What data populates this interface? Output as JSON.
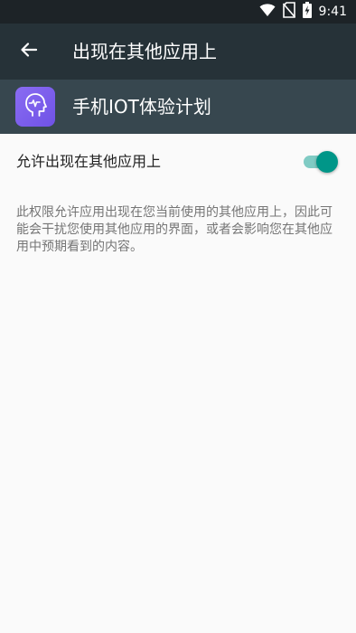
{
  "status_bar": {
    "time": "9:41",
    "icons": [
      "wifi-icon",
      "no-sim-icon",
      "battery-charging-icon"
    ]
  },
  "toolbar": {
    "back_icon": "arrow-back-icon",
    "title": "出现在其他应用上"
  },
  "app_header": {
    "icon": "head-pulse-icon",
    "name": "手机IOT体验计划"
  },
  "setting": {
    "label": "允许出现在其他应用上",
    "enabled": true
  },
  "description": "此权限允许应用出现在您当前使用的其他应用上，因此可能会干扰您使用其他应用的界面，或者会影响您在其他应用中预期看到的内容。",
  "colors": {
    "status_bar": "#1d2327",
    "toolbar": "#263238",
    "app_header": "#37474f",
    "accent": "#009688",
    "accent_track": "#80cbc4",
    "app_icon": "#7a5cee"
  }
}
